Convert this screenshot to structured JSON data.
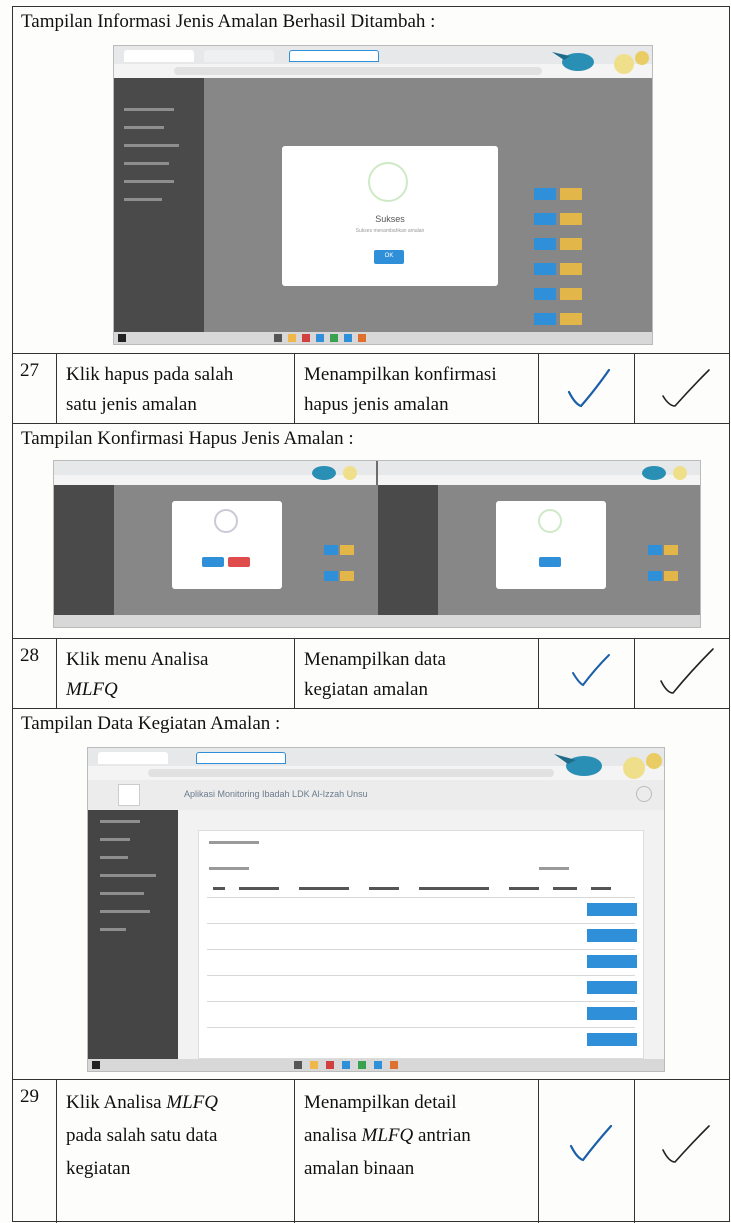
{
  "captions": {
    "c1": "Tampilan Informasi Jenis Amalan Berhasil Ditambah :",
    "c2": "Tampilan Konfirmasi Hapus Jenis Amalan :",
    "c3": "Tampilan Data Kegiatan Amalan :"
  },
  "steps": [
    {
      "no": "27",
      "action_lines": [
        "Klik hapus pada salah",
        "satu jenis amalan"
      ],
      "result_lines": [
        "Menampilkan konfirmasi",
        "hapus jenis amalan"
      ]
    },
    {
      "no": "28",
      "action_line1": "Klik menu Analisa",
      "action_line2_italic": "MLFQ",
      "result_lines": [
        "Menampilkan data",
        "kegiatan amalan"
      ]
    },
    {
      "no": "29",
      "action_line1_prefix": "Klik Analisa ",
      "action_line1_italic": "MLFQ",
      "action_lines_rest": [
        "pada salah satu data",
        "kegiatan"
      ],
      "result_line1": "Menampilkan detail",
      "result_line2_prefix": "analisa ",
      "result_line2_italic": "MLFQ",
      "result_line2_suffix": " antrian",
      "result_line3": "amalan binaan"
    }
  ],
  "screens": {
    "s1_modal_title": "Sukses",
    "s1_modal_text": "Sukses menambahkan amalan",
    "s1_ok": "OK",
    "s3_app_title": "Aplikasi Monitoring Ibadah LDK Al-Izzah Unsu"
  },
  "colors": {
    "ink": "#111111",
    "check": "#1a5fa8",
    "accent": "#2f8fd8"
  }
}
